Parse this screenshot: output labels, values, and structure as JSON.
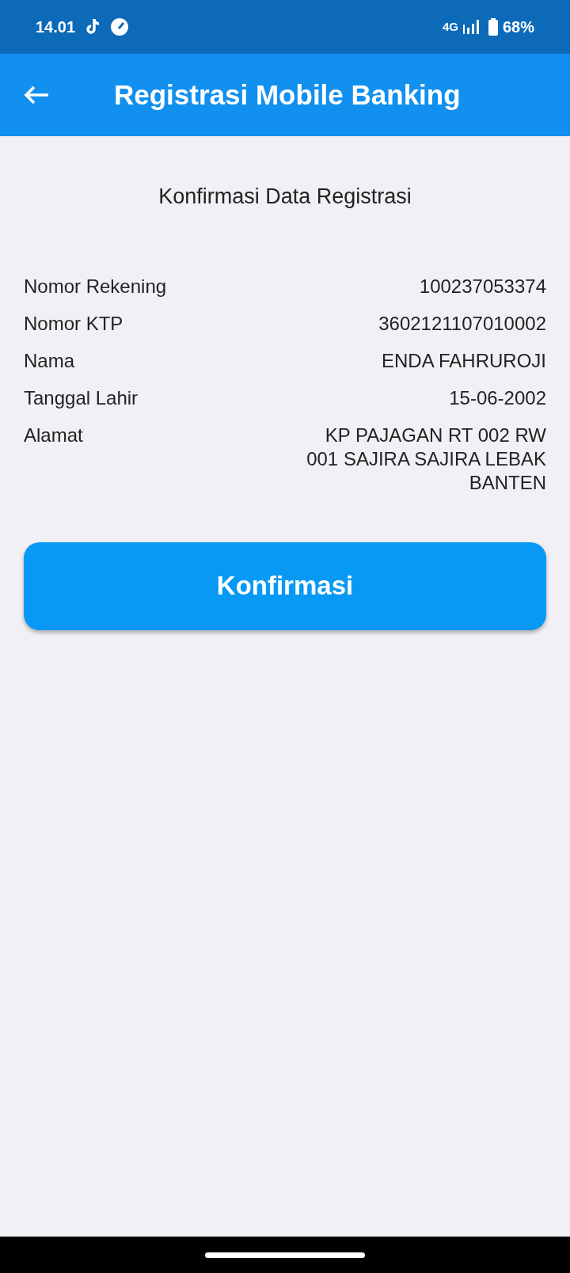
{
  "status_bar": {
    "time": "14.01",
    "network": "4G",
    "battery": "68%"
  },
  "app_bar": {
    "title": "Registrasi Mobile Banking"
  },
  "heading": "Konfirmasi Data Registrasi",
  "fields": [
    {
      "label": "Nomor Rekening",
      "value": "100237053374"
    },
    {
      "label": "Nomor KTP",
      "value": "3602121107010002"
    },
    {
      "label": "Nama",
      "value": "ENDA FAHRUROJI"
    },
    {
      "label": "Tanggal Lahir",
      "value": "15-06-2002"
    },
    {
      "label": "Alamat",
      "value": "KP PAJAGAN RT 002 RW 001 SAJIRA SAJIRA LEBAK BANTEN"
    }
  ],
  "button": "Konfirmasi"
}
